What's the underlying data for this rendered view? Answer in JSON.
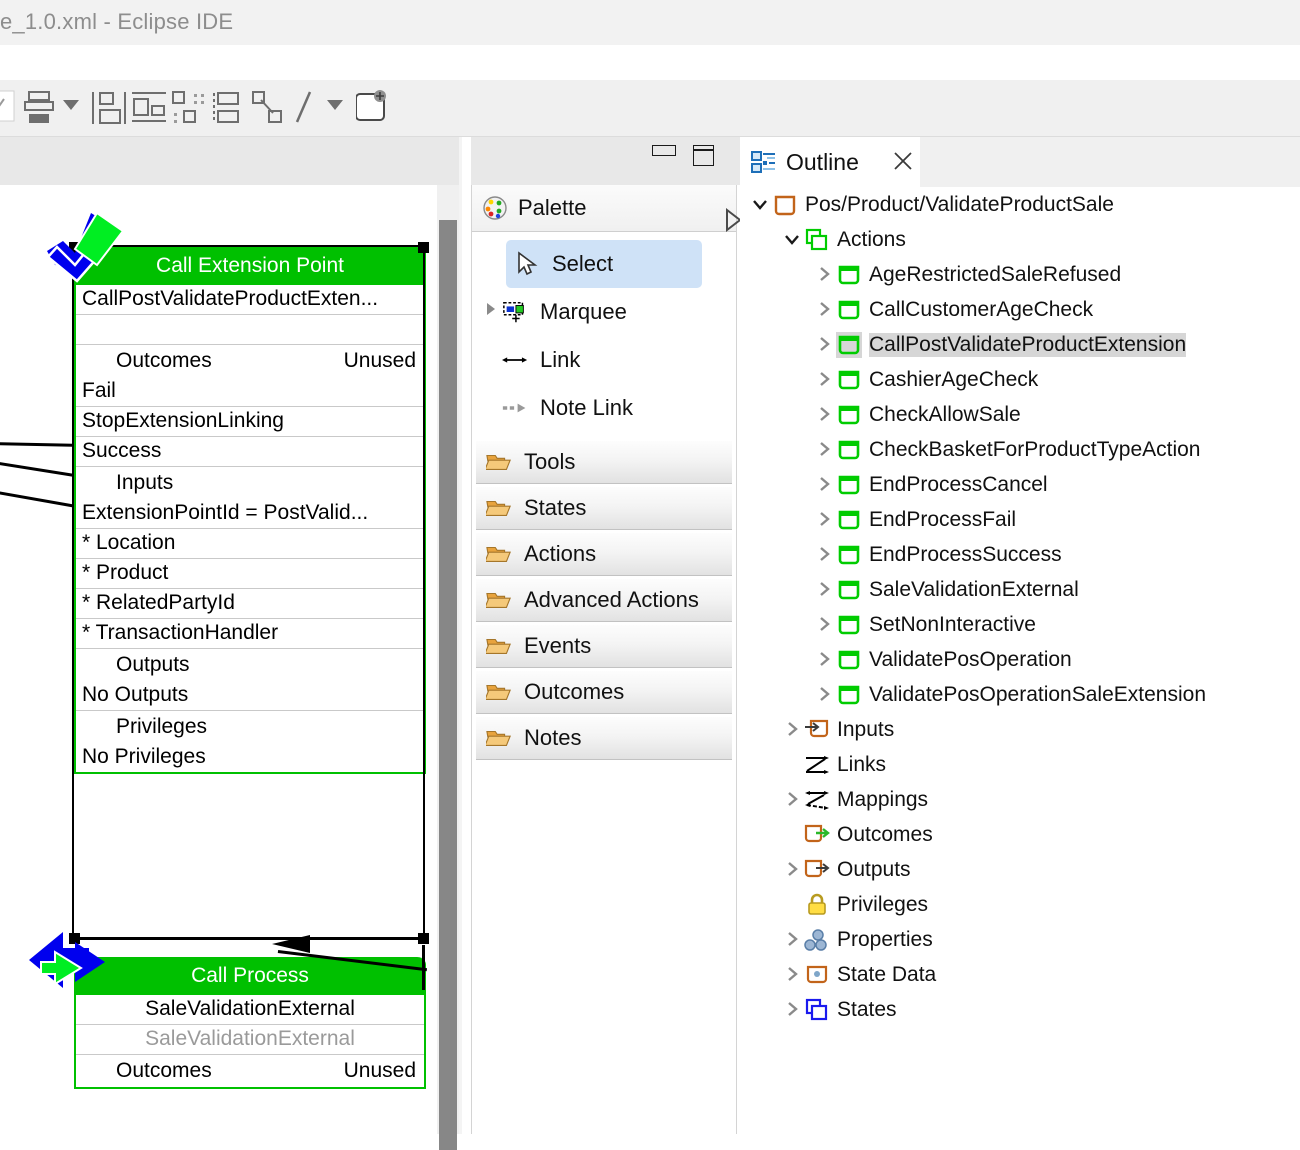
{
  "window": {
    "title": "e_1.0.xml - Eclipse IDE"
  },
  "toolbar": {
    "items": [
      {
        "name": "align-bottom-icon",
        "label": ""
      },
      {
        "name": "align-dropdown-icon",
        "label": ""
      },
      {
        "name": "match-width-icon",
        "label": ""
      },
      {
        "name": "match-height-icon",
        "label": ""
      },
      {
        "name": "distribute-icon",
        "label": ""
      },
      {
        "name": "order-icon",
        "label": ""
      },
      {
        "name": "route-icon",
        "label": ""
      },
      {
        "name": "line-style-icon",
        "label": ""
      },
      {
        "name": "line-dropdown-icon",
        "label": ""
      },
      {
        "name": "note-icon",
        "label": ""
      }
    ],
    "zoom_slider": {
      "name": "zoom-slider"
    }
  },
  "editor": {
    "minimize_tooltip": "Minimize",
    "maximize_tooltip": "Maximize",
    "nodes": [
      {
        "id": "call-extension-point",
        "header": "Call Extension Point",
        "name": "CallPostValidateProductExten...",
        "sections": [
          {
            "title": "Outcomes",
            "right": "Unused",
            "rows": [
              "Fail",
              "StopExtensionLinking",
              "Success"
            ]
          },
          {
            "title": "Inputs",
            "right": "",
            "rows": [
              "ExtensionPointId = PostValid...",
              "* Location",
              "* Product",
              "* RelatedPartyId",
              "* TransactionHandler"
            ]
          },
          {
            "title": "Outputs",
            "right": "",
            "rows": [
              "No Outputs"
            ]
          },
          {
            "title": "Privileges",
            "right": "",
            "rows": [
              "No Privileges"
            ]
          }
        ]
      },
      {
        "id": "call-process",
        "header": "Call Process",
        "name": "SaleValidationExternal",
        "subname": "SaleValidationExternal",
        "sections": [
          {
            "title": "Outcomes",
            "right": "Unused",
            "rows": []
          }
        ]
      }
    ]
  },
  "palette": {
    "title": "Palette",
    "pin_icon": "palette-icon",
    "collapse_icon": "expand-arrow-icon",
    "tools": [
      {
        "label": "Select",
        "icon": "cursor-icon",
        "selected": true,
        "has_twisty": false
      },
      {
        "label": "Marquee",
        "icon": "marquee-icon",
        "selected": false,
        "has_twisty": true
      },
      {
        "label": "Link",
        "icon": "link-icon",
        "selected": false,
        "has_twisty": false
      },
      {
        "label": "Note Link",
        "icon": "note-link-icon",
        "selected": false,
        "has_twisty": false
      }
    ],
    "drawers": [
      {
        "label": "Tools",
        "icon": "folder-icon"
      },
      {
        "label": "States",
        "icon": "folder-icon"
      },
      {
        "label": "Actions",
        "icon": "folder-icon"
      },
      {
        "label": "Advanced Actions",
        "icon": "folder-icon"
      },
      {
        "label": "Events",
        "icon": "folder-icon"
      },
      {
        "label": "Outcomes",
        "icon": "folder-icon"
      },
      {
        "label": "Notes",
        "icon": "folder-icon"
      }
    ]
  },
  "outline": {
    "tab_label": "Outline",
    "tab_icon": "outline-icon",
    "close_icon": "close-icon",
    "tree": [
      {
        "label": "Pos/Product/ValidateProductSale",
        "indent": 0,
        "twisty": "down",
        "icon": "process-icon",
        "selected": false
      },
      {
        "label": "Actions",
        "indent": 1,
        "twisty": "down",
        "icon": "actions-group-icon",
        "selected": false
      },
      {
        "label": "AgeRestrictedSaleRefused",
        "indent": 2,
        "twisty": "right",
        "icon": "action-icon",
        "selected": false
      },
      {
        "label": "CallCustomerAgeCheck",
        "indent": 2,
        "twisty": "right",
        "icon": "action-icon",
        "selected": false
      },
      {
        "label": "CallPostValidateProductExtension",
        "indent": 2,
        "twisty": "right",
        "icon": "action-icon",
        "selected": true
      },
      {
        "label": "CashierAgeCheck",
        "indent": 2,
        "twisty": "right",
        "icon": "action-icon",
        "selected": false
      },
      {
        "label": "CheckAllowSale",
        "indent": 2,
        "twisty": "right",
        "icon": "action-icon",
        "selected": false
      },
      {
        "label": "CheckBasketForProductTypeAction",
        "indent": 2,
        "twisty": "right",
        "icon": "action-icon",
        "selected": false
      },
      {
        "label": "EndProcessCancel",
        "indent": 2,
        "twisty": "right",
        "icon": "action-icon",
        "selected": false
      },
      {
        "label": "EndProcessFail",
        "indent": 2,
        "twisty": "right",
        "icon": "action-icon",
        "selected": false
      },
      {
        "label": "EndProcessSuccess",
        "indent": 2,
        "twisty": "right",
        "icon": "action-icon",
        "selected": false
      },
      {
        "label": "SaleValidationExternal",
        "indent": 2,
        "twisty": "right",
        "icon": "action-icon",
        "selected": false
      },
      {
        "label": "SetNonInteractive",
        "indent": 2,
        "twisty": "right",
        "icon": "action-icon",
        "selected": false
      },
      {
        "label": "ValidatePosOperation",
        "indent": 2,
        "twisty": "right",
        "icon": "action-icon",
        "selected": false
      },
      {
        "label": "ValidatePosOperationSaleExtension",
        "indent": 2,
        "twisty": "right",
        "icon": "action-icon",
        "selected": false
      },
      {
        "label": "Inputs",
        "indent": 1,
        "twisty": "right",
        "icon": "inputs-icon",
        "selected": false
      },
      {
        "label": "Links",
        "indent": 1,
        "twisty": "none",
        "icon": "links-icon",
        "selected": false
      },
      {
        "label": "Mappings",
        "indent": 1,
        "twisty": "right",
        "icon": "mappings-icon",
        "selected": false
      },
      {
        "label": "Outcomes",
        "indent": 1,
        "twisty": "none",
        "icon": "outcomes-icon",
        "selected": false
      },
      {
        "label": "Outputs",
        "indent": 1,
        "twisty": "right",
        "icon": "outputs-icon",
        "selected": false
      },
      {
        "label": "Privileges",
        "indent": 1,
        "twisty": "none",
        "icon": "lock-icon",
        "selected": false
      },
      {
        "label": "Properties",
        "indent": 1,
        "twisty": "right",
        "icon": "properties-icon",
        "selected": false
      },
      {
        "label": "State Data",
        "indent": 1,
        "twisty": "right",
        "icon": "state-data-icon",
        "selected": false
      },
      {
        "label": "States",
        "indent": 1,
        "twisty": "right",
        "icon": "states-icon",
        "selected": false
      }
    ]
  },
  "colors": {
    "node_green": "#00c000",
    "accent_blue": "#0000ee",
    "selection_grey": "#d6d6d6",
    "palette_select": "#cfe2f7"
  }
}
